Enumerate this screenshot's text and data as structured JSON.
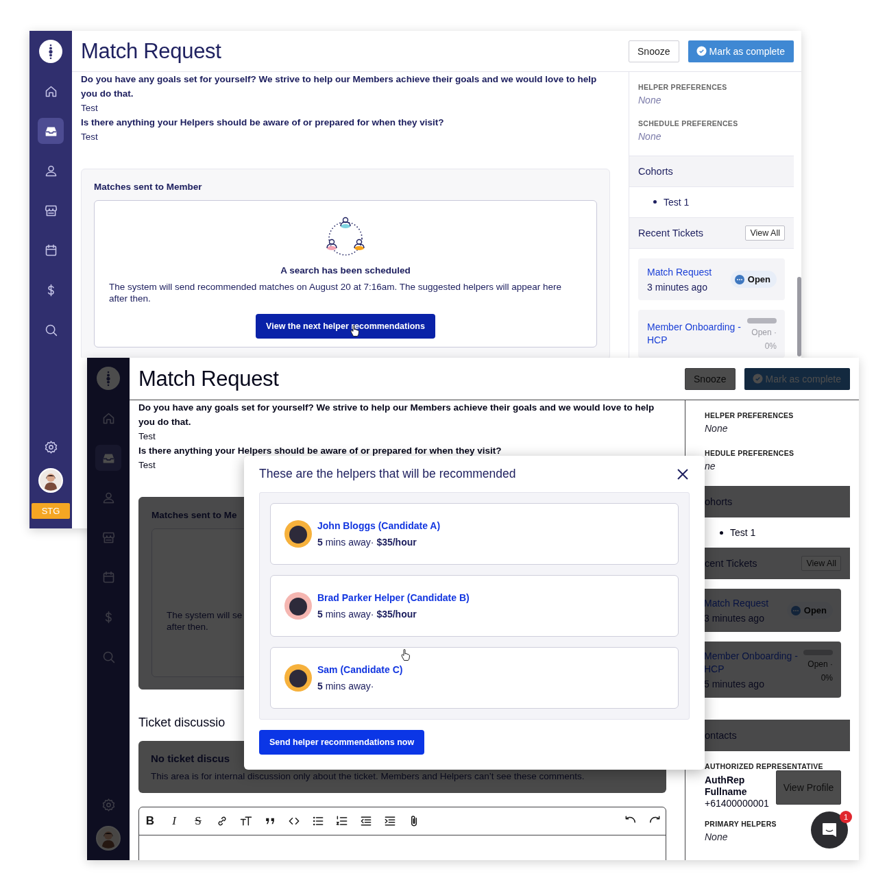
{
  "windows": [
    {
      "kind": "back",
      "dimmed": false,
      "title": "Match Request",
      "snooze": "Snooze",
      "complete": "Mark as complete",
      "sidebar": {
        "items": [
          {
            "kind": "home",
            "selected": false
          },
          {
            "kind": "inbox",
            "selected": true
          },
          {
            "kind": "person",
            "selected": false
          },
          {
            "kind": "store",
            "selected": false
          },
          {
            "kind": "calendar",
            "selected": false
          },
          {
            "kind": "dollar",
            "selected": false
          },
          {
            "kind": "search",
            "selected": false
          }
        ],
        "env_badge": "STG"
      },
      "questions": [
        {
          "kind": "question",
          "text": "Do you have any goals set for yourself? We strive to help our Members achieve their goals and we would love to help you do that."
        },
        {
          "kind": "answer",
          "text": "Test"
        },
        {
          "kind": "question",
          "text": "Is there anything your Helpers should be aware of or prepared for when they visit?"
        },
        {
          "kind": "answer",
          "text": "Test"
        }
      ],
      "matches": {
        "title": "Matches sent to Member",
        "heading": "A search has been scheduled",
        "text": "The system will send recommended matches on August 20 at 7:16am. The suggested helpers will appear here after then.",
        "button": "View the next helper recommendations"
      },
      "panel": [
        {
          "kind": "field",
          "label": "HELPER PREFERENCES",
          "value": "None"
        },
        {
          "kind": "field",
          "label": "SCHEDULE PREFERENCES",
          "value": "None"
        },
        {
          "kind": "section",
          "title": "Cohorts"
        },
        {
          "kind": "bullets",
          "items": [
            "Test 1"
          ]
        },
        {
          "kind": "section",
          "title": "Recent Tickets",
          "action": "View All"
        },
        {
          "kind": "ticket",
          "title": "Match Request",
          "time": "3 minutes ago",
          "status": "Open"
        },
        {
          "kind": "ticket",
          "title": "Member Onboarding - HCP",
          "status": "Open ·",
          "percent": "0%"
        }
      ]
    },
    {
      "kind": "front",
      "dimmed": true,
      "title": "Match Request",
      "snooze": "Snooze",
      "complete": "Mark as complete",
      "sidebar": {
        "items": [
          {
            "kind": "home",
            "selected": false
          },
          {
            "kind": "inbox",
            "selected": true
          },
          {
            "kind": "person",
            "selected": false
          },
          {
            "kind": "store",
            "selected": false
          },
          {
            "kind": "calendar",
            "selected": false
          },
          {
            "kind": "dollar",
            "selected": false
          },
          {
            "kind": "search",
            "selected": false
          }
        ]
      },
      "questions": [
        {
          "kind": "question",
          "text": "Do you have any goals set for yourself? We strive to help our Members achieve their goals and we would love to help you do that."
        },
        {
          "kind": "answer",
          "text": "Test"
        },
        {
          "kind": "question",
          "text": "Is there anything your Helpers should be aware of or prepared for when they visit?"
        },
        {
          "kind": "answer",
          "text": "Test"
        }
      ],
      "matches": {
        "title": "Matches sent to Me",
        "lines": [
          "The system will se",
          "after then."
        ]
      },
      "discussion": {
        "title": "Ticket discussio",
        "empty_title": "No ticket discus",
        "empty_text": "This area is for internal discussion only about the ticket. Members and Helpers can’t see these comments."
      },
      "toolbar": [
        {
          "kind": "bold",
          "label": "B"
        },
        {
          "kind": "italic",
          "label": "I"
        },
        {
          "kind": "strike",
          "label": "S"
        },
        {
          "kind": "link"
        },
        {
          "kind": "heading"
        },
        {
          "kind": "quote"
        },
        {
          "kind": "code"
        },
        {
          "kind": "bullets"
        },
        {
          "kind": "numbers"
        },
        {
          "kind": "outdent"
        },
        {
          "kind": "indent"
        },
        {
          "kind": "attach"
        },
        {
          "kind": "undo"
        },
        {
          "kind": "redo"
        }
      ],
      "panel": [
        {
          "kind": "field",
          "label": "HELPER PREFERENCES",
          "value": "None"
        },
        {
          "kind": "field",
          "label": "HEDULE PREFERENCES",
          "value": "ne"
        },
        {
          "kind": "section",
          "title": "ohorts"
        },
        {
          "kind": "bullets",
          "items": [
            "Test 1"
          ]
        },
        {
          "kind": "section",
          "title": "cent Tickets",
          "action": "View All"
        },
        {
          "kind": "ticket",
          "title": "Match Request",
          "time": "3 minutes ago",
          "status": "Open"
        },
        {
          "kind": "ticket",
          "title": "Member Onboarding - HCP",
          "time": "5 minutes ago",
          "status": "Open ·",
          "percent": "0%"
        },
        {
          "kind": "section",
          "title": "ontacts"
        },
        {
          "kind": "contact",
          "label": "AUTHORIZED REPRESENTATIVE",
          "name": "AuthRep Fullname",
          "phone": "+61400000001",
          "button": "View Profile"
        },
        {
          "kind": "field",
          "label": "PRIMARY HELPERS",
          "value": "None"
        }
      ]
    }
  ],
  "modal": {
    "title": "These are the helpers that will be recommended",
    "helpers": [
      {
        "name": "John Bloggs (Candidate A)",
        "meta": "**5** mins away· **$35/hour**",
        "color": "#f6b13c"
      },
      {
        "name": "Brad Parker Helper (Candidate B)",
        "meta": "**5** mins away· **$35/hour**",
        "color": "#f5b6b1"
      },
      {
        "name": "Sam (Candidate C)",
        "meta": "**5** mins away·",
        "color": "#f6b13c"
      }
    ],
    "button": "Send helper recommendations now"
  },
  "chat": {
    "badge": "1"
  }
}
